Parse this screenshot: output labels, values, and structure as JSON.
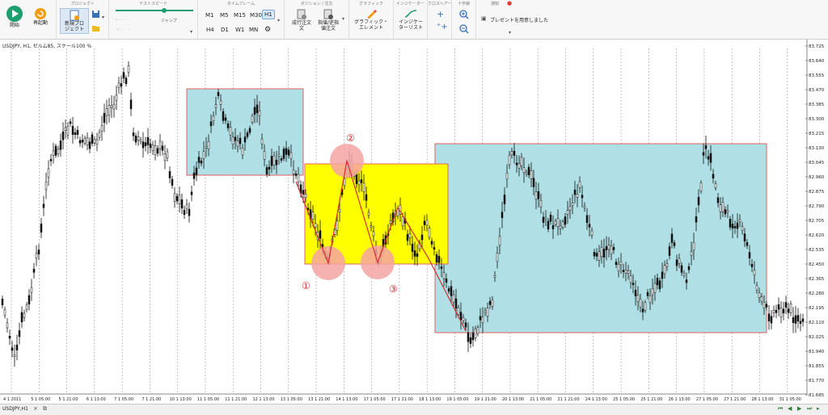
{
  "toolbar": {
    "start_label": "開始",
    "restart_label": "再起動",
    "project_group": "プロジェクト",
    "new_project_label": "新規プロ\nジェクト",
    "test_speed_group": "テストスピード",
    "jump_label": "ジャンプ",
    "timeframe_group": "タイムフレーム",
    "timeframes": [
      "M1",
      "M5",
      "M15",
      "M30",
      "H1",
      "H4",
      "D1",
      "W1",
      "MN"
    ],
    "selected_timeframe": "H1",
    "positions_group": "ポジション / 注文",
    "market_order_label": "成行注文\n文",
    "pending_order_label": "指値/逆指\n値注文",
    "graphics_group": "グラフィック",
    "graphic_element_label": "グラフィック・\nエレメント",
    "indicators_group": "インジケーター",
    "indicator_list_label": "インジケー\nターリスト",
    "crosshair_group": "クロスヘアー",
    "magnifier_group": "十字線",
    "notice_group": "通知",
    "notice_text": "プレゼントを用意しました"
  },
  "chart": {
    "label": "USDJPY, H1, ゼルム85, スケール100 %",
    "price_labels": [
      "83.725",
      "83.640",
      "83.555",
      "83.470",
      "83.385",
      "83.300",
      "83.215",
      "83.130",
      "83.045",
      "82.960",
      "82.875",
      "82.790",
      "82.705",
      "82.620",
      "82.535",
      "82.450",
      "82.365",
      "82.280",
      "82.195",
      "82.110",
      "82.025",
      "81.940",
      "81.855",
      "81.770",
      "81.685"
    ],
    "time_labels": [
      "4 1 2011",
      "5 1 05:00",
      "5 1 21:00",
      "6 1 13:00",
      "7 1 05:00",
      "7 1 21:00",
      "10 1 13:00",
      "11 1 05:00",
      "11 1 21:00",
      "12 1 13:00",
      "13 1 05:00",
      "13 1 21:00",
      "14 1 13:00",
      "17 1 05:00",
      "17 1 21:00",
      "18 1 13:00",
      "19 1 05:00",
      "19 1 21:00",
      "20 1 13:00",
      "21 1 05:00",
      "21 1 21:00",
      "24 1 13:00",
      "25 1 05:00",
      "25 1 21:00",
      "26 1 13:00",
      "27 1 05:00",
      "27 1 21:00",
      "28 1 13:00",
      "31 1 05:00"
    ],
    "marker_labels": [
      "①",
      "②",
      "③"
    ],
    "colors": {
      "range_box": "#b0e0e6",
      "pattern_box": "#ffff00",
      "box_border": "#e06060",
      "circle": "#f5a3a3",
      "trend_line": "#d32f2f"
    }
  },
  "bottom": {
    "tab_label": "USDJPY,H1",
    "close_glyph": "×"
  }
}
